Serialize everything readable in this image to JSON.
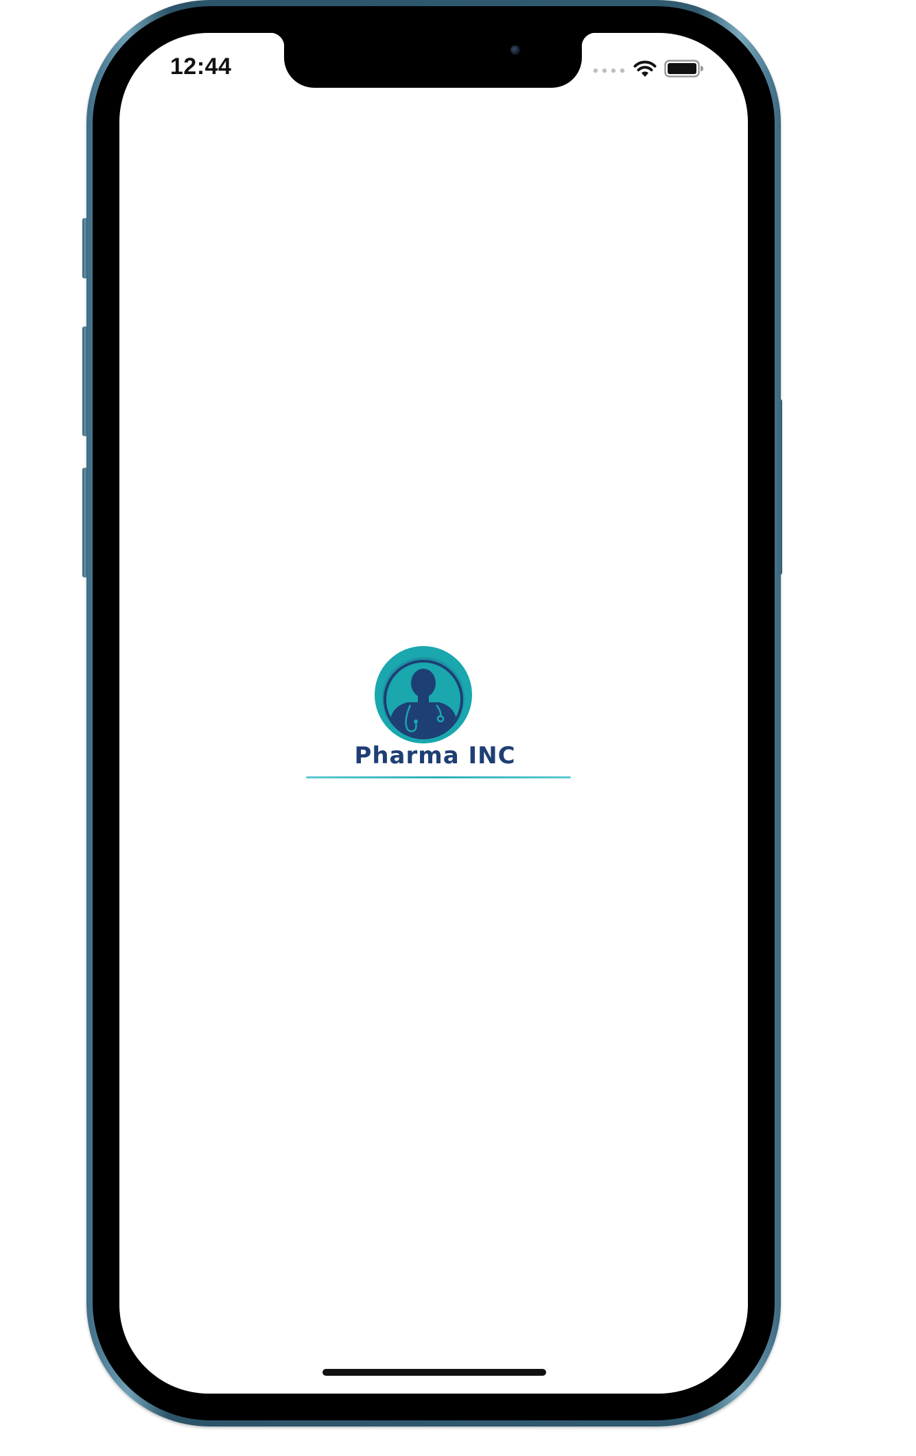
{
  "status_bar": {
    "time": "12:44",
    "icons": [
      "cellular-signal-icon",
      "wifi-icon",
      "battery-icon"
    ]
  },
  "splash": {
    "brand_name": "Pharma INC",
    "logo_icon": "doctor-with-stethoscope-icon",
    "colors": {
      "logo_teal": "#1aa7ae",
      "logo_navy": "#1e3f74",
      "underline": "#2ab0ba"
    }
  },
  "device": {
    "frame_color": "#3f6e86"
  }
}
